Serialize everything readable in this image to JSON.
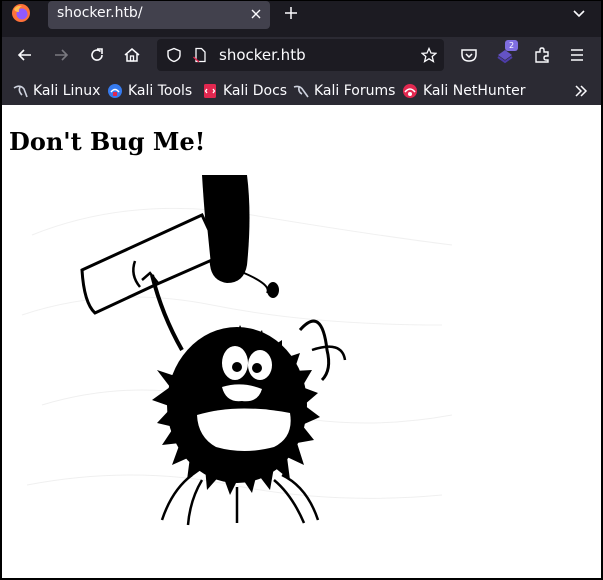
{
  "browser": {
    "tab": {
      "title": "shocker.htb/"
    },
    "urlbar": {
      "url": "shocker.htb"
    },
    "extension_badge": "2",
    "bookmarks": [
      {
        "label": "Kali Linux",
        "icon": "kali-dragon-icon"
      },
      {
        "label": "Kali Tools",
        "icon": "kali-tools-icon"
      },
      {
        "label": "Kali Docs",
        "icon": "kali-docs-icon"
      },
      {
        "label": "Kali Forums",
        "icon": "kali-forums-icon"
      },
      {
        "label": "Kali NetHunter",
        "icon": "kali-nethunter-icon"
      }
    ]
  },
  "page": {
    "heading": "Don't Bug Me!",
    "image": "cartoon-bug-with-hammer"
  },
  "colors": {
    "tabstrip": "#1c1b22",
    "toolbar": "#2b2a33",
    "tab_active": "#42414d",
    "text": "#fbfbfe",
    "accent": "#7f6ee0",
    "page_bg": "#ffffff"
  }
}
